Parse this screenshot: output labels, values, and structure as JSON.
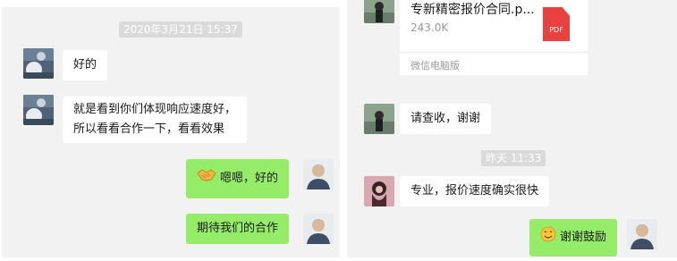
{
  "left_chat": {
    "timestamp": "2020年3月21日 15:37",
    "messages": [
      {
        "side": "incoming",
        "text": "好的"
      },
      {
        "side": "incoming",
        "lines": [
          "就是看到你们体现响应速度好，",
          "所以看看合作一下，看看效果"
        ]
      },
      {
        "side": "outgoing",
        "emoji": "handshake-emoji",
        "text": "嗯嗯，好的"
      },
      {
        "side": "outgoing",
        "text": "期待我们的合作"
      }
    ]
  },
  "right_chat": {
    "file_card": {
      "name": "专新精密报价合同.p...",
      "size": "243.0K",
      "icon_label": "PDF",
      "source": "微信电脑版"
    },
    "messages": [
      {
        "side": "incoming",
        "text": "请查收，谢谢"
      },
      {
        "side": "incoming",
        "text": "专业，报价速度确实很快"
      },
      {
        "side": "outgoing",
        "emoji": "smile-emoji",
        "text": "谢谢鼓励"
      }
    ],
    "timestamp": "昨天 11:33"
  },
  "colors": {
    "panel_bg": "#f2f2f2",
    "outgoing_bubble": "#95ec69",
    "incoming_bubble": "#ffffff",
    "timestamp_bg": "#dadada",
    "pdf_red": "#e8413f"
  }
}
